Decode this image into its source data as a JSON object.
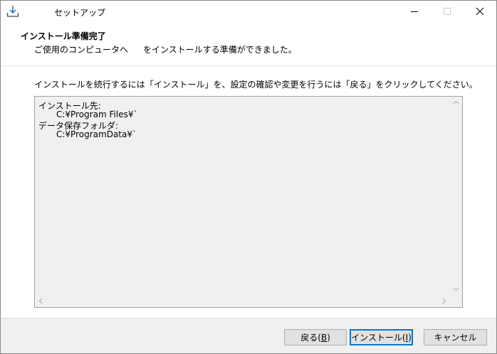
{
  "window": {
    "title": "セットアップ"
  },
  "header": {
    "heading": "インストール準備完了",
    "subheading_before": "ご使用のコンピュータへ",
    "subheading_after": "をインストールする準備ができました。"
  },
  "body": {
    "instruction": "インストールを続行するには「インストール」を、設定の確認や変更を行うには「戻る」をクリックしてください。",
    "memo_lines": [
      "インストール先:",
      "C:¥Program Files¥`",
      "データ保存フォルダ:",
      "C:¥ProgramData¥`"
    ]
  },
  "buttons": {
    "back_label": "戻る(",
    "back_key": "B",
    "back_close": ")",
    "install_label": "インストール(",
    "install_key": "I",
    "install_close": ")",
    "cancel_label": "キャンセル"
  },
  "icons": {
    "app": "install-download-icon",
    "minimize": "minimize-icon",
    "maximize": "maximize-icon",
    "close": "close-icon"
  },
  "colors": {
    "accent": "#0078d7",
    "footer_bg": "#f0f0f0",
    "memo_bg": "#f0f0f0"
  }
}
